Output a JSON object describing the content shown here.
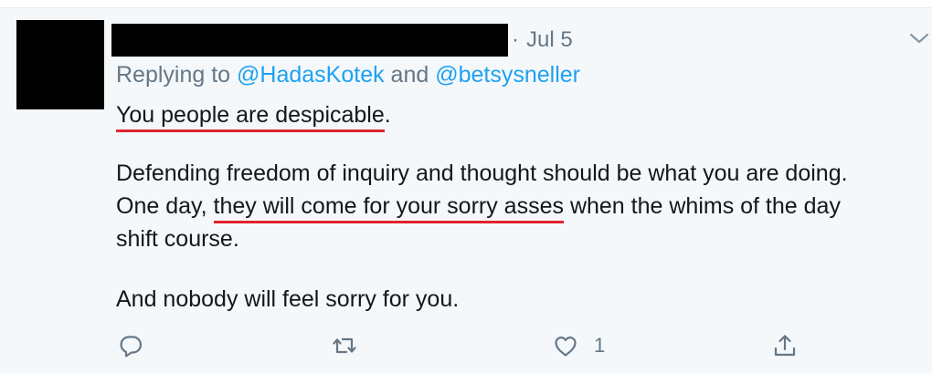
{
  "tweet": {
    "separator": "·",
    "timestamp": "Jul 5",
    "replying_prefix": "Replying to ",
    "mention_1": "@HadasKotek",
    "and_word": " and ",
    "mention_2": "@betsysneller",
    "line1_underlined": "You people are despicable",
    "line1_end": ".",
    "line2": "Defending freedom of inquiry and thought should be what you are doing.",
    "line3_start": "One day, ",
    "line3_underlined": "they will come for your sorry asses",
    "line3_end": " when the whims of the day",
    "line4": "shift course.",
    "line5": "And nobody will feel sorry for you."
  },
  "actions": {
    "reply_icon": "reply-icon",
    "retweet_icon": "retweet-icon",
    "like_icon": "heart-icon",
    "like_count": "1",
    "share_icon": "share-icon"
  },
  "colors": {
    "background": "#f5f8fa",
    "text": "#14171a",
    "muted": "#657786",
    "mention": "#1da1f2",
    "underline": "#e0242f"
  }
}
